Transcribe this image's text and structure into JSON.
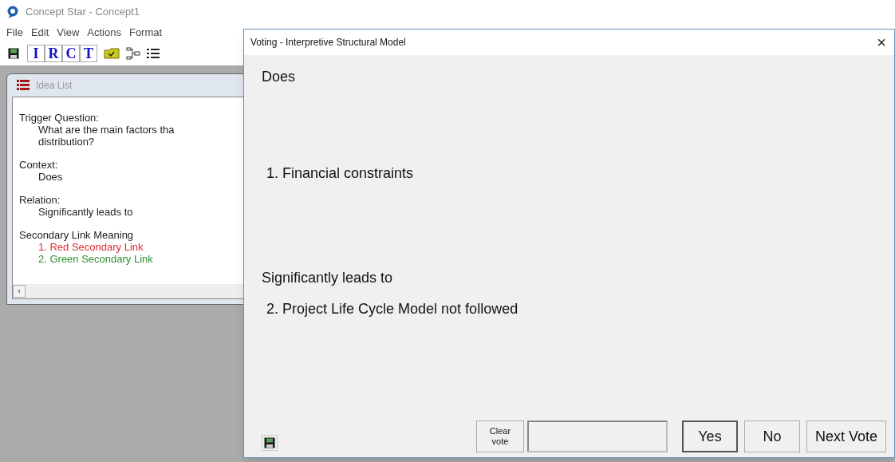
{
  "app": {
    "title": "Concept Star - Concept1",
    "menu": [
      "File",
      "Edit",
      "View",
      "Actions",
      "Format"
    ],
    "toolbar_letters": [
      "I",
      "R",
      "C",
      "T"
    ]
  },
  "idea_list": {
    "title": "Idea List",
    "sections": [
      {
        "heading": "Trigger Question:",
        "lines": [
          {
            "text": "What are the main factors tha"
          },
          {
            "text": "distribution?"
          }
        ]
      },
      {
        "heading": "Context:",
        "lines": [
          {
            "text": "Does"
          }
        ]
      },
      {
        "heading": "Relation:",
        "lines": [
          {
            "text": "Significantly leads to"
          }
        ]
      },
      {
        "heading": "Secondary Link Meaning",
        "lines": [
          {
            "text": "1. Red Secondary Link",
            "color": "#e02a30"
          },
          {
            "text": "2. Green Secondary Link",
            "color": "#2e8f2e"
          }
        ]
      }
    ]
  },
  "dialog": {
    "title": "Voting - Interpretive Structural Model",
    "close": "×",
    "context": "Does",
    "idea_1": "1. Financial constraints",
    "relation": "Significantly leads to",
    "idea_2": "2. Project Life Cycle Model not followed",
    "clear_button": [
      "Clear",
      "vote"
    ],
    "buttons": [
      {
        "label": "Yes",
        "default": true
      },
      {
        "label": "No",
        "default": false
      },
      {
        "label": "Next Vote",
        "default": false
      }
    ]
  }
}
